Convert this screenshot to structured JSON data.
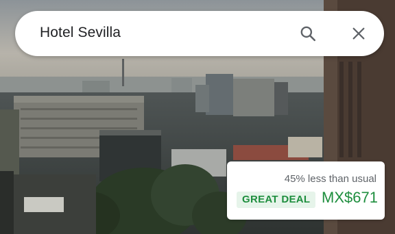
{
  "search": {
    "query": "Hotel Sevilla"
  },
  "icons": {
    "search": "search-icon",
    "close": "close-icon"
  },
  "price_card": {
    "comparison_text": "45% less than usual",
    "badge_label": "GREAT DEAL",
    "price": "MX$671"
  },
  "colors": {
    "deal_green": "#1e8e3e",
    "badge_bg": "#e6f4ea",
    "text_primary": "#202124",
    "text_secondary": "#5f6368"
  }
}
